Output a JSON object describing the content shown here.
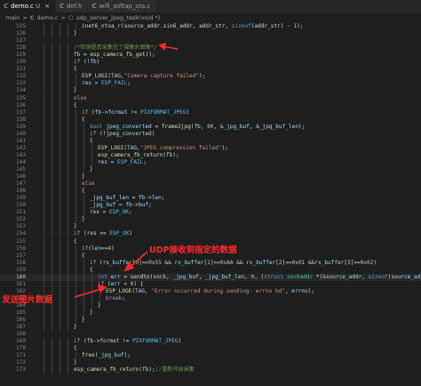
{
  "tabs": [
    {
      "icon": "c-file-icon",
      "label": "demo.c",
      "badge": "U",
      "active": true
    },
    {
      "icon": "c-file-icon",
      "label": "def.h",
      "badge": "",
      "active": false
    },
    {
      "icon": "c-file-icon",
      "label": "wifi_softap_sta.c",
      "badge": "",
      "active": false
    }
  ],
  "tab_close": "×",
  "breadcrumb": {
    "root": "main",
    "sep1": ">",
    "file": "demo.c",
    "sep2": ">",
    "func": "udp_server_jpeg_task(void *)"
  },
  "annotations": {
    "udp_recv": "UDP接收到指定的数据",
    "send_image": "发送图片数据"
  },
  "colors": {
    "annotation": "#ff2a2a",
    "background": "#1e1e1e"
  },
  "lines": [
    {
      "no": "125",
      "indent": 5,
      "tokens": [
        [
          "f",
          "inet6_ntoa_r"
        ],
        [
          "p",
          "(source_addr.sin6_addr, addr_str, "
        ],
        [
          "k",
          "sizeof"
        ],
        [
          "p",
          "(addr_str) - "
        ],
        [
          "n",
          "1"
        ],
        [
          "p",
          ");"
        ]
      ]
    },
    {
      "no": "126",
      "indent": 4,
      "tokens": [
        [
          "p",
          "}"
        ]
      ]
    },
    {
      "no": "127",
      "indent": 0,
      "tokens": []
    },
    {
      "no": "128",
      "indent": 4,
      "tokens": [
        [
          "c",
          "/*检测是否采集完了摄像头图像*/"
        ]
      ]
    },
    {
      "no": "129",
      "indent": 4,
      "tokens": [
        [
          "v",
          "fb"
        ],
        [
          "p",
          " = "
        ],
        [
          "f",
          "esp_camera_fb_get"
        ],
        [
          "p",
          "();"
        ]
      ]
    },
    {
      "no": "130",
      "indent": 4,
      "tokens": [
        [
          "kc",
          "if"
        ],
        [
          "p",
          " (!"
        ],
        [
          "v",
          "fb"
        ],
        [
          "p",
          ")"
        ]
      ]
    },
    {
      "no": "131",
      "indent": 4,
      "tokens": [
        [
          "p",
          "{"
        ]
      ]
    },
    {
      "no": "132",
      "indent": 5,
      "tokens": [
        [
          "f",
          "ESP_LOGI"
        ],
        [
          "p",
          "("
        ],
        [
          "v",
          "TAG"
        ],
        [
          "p",
          ","
        ],
        [
          "s",
          "\"Camera capture failed\""
        ],
        [
          "p",
          ");"
        ]
      ]
    },
    {
      "no": "133",
      "indent": 5,
      "tokens": [
        [
          "v",
          "res"
        ],
        [
          "p",
          " = "
        ],
        [
          "m",
          "ESP_FAIL"
        ],
        [
          "p",
          ";"
        ]
      ]
    },
    {
      "no": "134",
      "indent": 4,
      "tokens": [
        [
          "p",
          "}"
        ]
      ]
    },
    {
      "no": "135",
      "indent": 4,
      "tokens": [
        [
          "kc",
          "else"
        ]
      ]
    },
    {
      "no": "136",
      "indent": 4,
      "tokens": [
        [
          "p",
          "{"
        ]
      ]
    },
    {
      "no": "137",
      "indent": 5,
      "tokens": [
        [
          "kc",
          "if"
        ],
        [
          "p",
          " ("
        ],
        [
          "v",
          "fb"
        ],
        [
          "p",
          "->"
        ],
        [
          "v",
          "format"
        ],
        [
          "p",
          " != "
        ],
        [
          "m",
          "PIXFORMAT_JPEG"
        ],
        [
          "p",
          ")"
        ]
      ]
    },
    {
      "no": "138",
      "indent": 5,
      "tokens": [
        [
          "p",
          "{"
        ]
      ]
    },
    {
      "no": "139",
      "indent": 6,
      "tokens": [
        [
          "k",
          "bool"
        ],
        [
          "p",
          " "
        ],
        [
          "v",
          "jpeg_converted"
        ],
        [
          "p",
          " = "
        ],
        [
          "f",
          "frame2jpg"
        ],
        [
          "p",
          "("
        ],
        [
          "v",
          "fb"
        ],
        [
          "p",
          ", "
        ],
        [
          "n",
          "80"
        ],
        [
          "p",
          ", &"
        ],
        [
          "v",
          "_jpg_buf"
        ],
        [
          "p",
          ", &"
        ],
        [
          "v",
          "_jpg_buf_len"
        ],
        [
          "p",
          ");"
        ]
      ]
    },
    {
      "no": "140",
      "indent": 6,
      "tokens": [
        [
          "kc",
          "if"
        ],
        [
          "p",
          " (!"
        ],
        [
          "v",
          "jpeg_converted"
        ],
        [
          "p",
          ")"
        ]
      ]
    },
    {
      "no": "141",
      "indent": 6,
      "tokens": [
        [
          "p",
          "{"
        ]
      ]
    },
    {
      "no": "142",
      "indent": 7,
      "tokens": [
        [
          "f",
          "ESP_LOGI"
        ],
        [
          "p",
          "("
        ],
        [
          "v",
          "TAG"
        ],
        [
          "p",
          ","
        ],
        [
          "s",
          "\"JPEG compression failed\""
        ],
        [
          "p",
          ");"
        ]
      ]
    },
    {
      "no": "143",
      "indent": 7,
      "tokens": [
        [
          "f",
          "esp_camera_fb_return"
        ],
        [
          "p",
          "("
        ],
        [
          "v",
          "fb"
        ],
        [
          "p",
          ");"
        ]
      ]
    },
    {
      "no": "144",
      "indent": 7,
      "tokens": [
        [
          "v",
          "res"
        ],
        [
          "p",
          " = "
        ],
        [
          "m",
          "ESP_FAIL"
        ],
        [
          "p",
          ";"
        ]
      ]
    },
    {
      "no": "145",
      "indent": 6,
      "tokens": [
        [
          "p",
          "}"
        ]
      ]
    },
    {
      "no": "146",
      "indent": 5,
      "tokens": [
        [
          "p",
          "}"
        ]
      ]
    },
    {
      "no": "147",
      "indent": 5,
      "tokens": [
        [
          "kc",
          "else"
        ]
      ]
    },
    {
      "no": "148",
      "indent": 5,
      "tokens": [
        [
          "p",
          "{"
        ]
      ]
    },
    {
      "no": "149",
      "indent": 6,
      "tokens": [
        [
          "v",
          "_jpg_buf_len"
        ],
        [
          "p",
          " = "
        ],
        [
          "v",
          "fb"
        ],
        [
          "p",
          "->"
        ],
        [
          "v",
          "len"
        ],
        [
          "p",
          ";"
        ]
      ]
    },
    {
      "no": "150",
      "indent": 6,
      "tokens": [
        [
          "v",
          "_jpg_buf"
        ],
        [
          "p",
          " = "
        ],
        [
          "v",
          "fb"
        ],
        [
          "p",
          "->"
        ],
        [
          "v",
          "buf"
        ],
        [
          "p",
          ";"
        ]
      ]
    },
    {
      "no": "151",
      "indent": 6,
      "tokens": [
        [
          "v",
          "res"
        ],
        [
          "p",
          " = "
        ],
        [
          "m",
          "ESP_OK"
        ],
        [
          "p",
          ";"
        ]
      ]
    },
    {
      "no": "152",
      "indent": 5,
      "tokens": [
        [
          "p",
          "}"
        ]
      ]
    },
    {
      "no": "153",
      "indent": 4,
      "tokens": [
        [
          "p",
          "}"
        ]
      ]
    },
    {
      "no": "154",
      "indent": 4,
      "tokens": [
        [
          "kc",
          "if"
        ],
        [
          "p",
          " ("
        ],
        [
          "v",
          "res"
        ],
        [
          "p",
          " == "
        ],
        [
          "m",
          "ESP_OK"
        ],
        [
          "p",
          ")"
        ]
      ]
    },
    {
      "no": "155",
      "indent": 4,
      "tokens": [
        [
          "p",
          "{"
        ]
      ]
    },
    {
      "no": "156",
      "indent": 5,
      "tokens": [
        [
          "kc",
          "if"
        ],
        [
          "p",
          "("
        ],
        [
          "v",
          "len"
        ],
        [
          "p",
          "=="
        ],
        [
          "n",
          "4"
        ],
        [
          "p",
          ")"
        ]
      ]
    },
    {
      "no": "157",
      "indent": 5,
      "tokens": [
        [
          "p",
          "{"
        ]
      ]
    },
    {
      "no": "158",
      "indent": 6,
      "tokens": [
        [
          "kc",
          "if"
        ],
        [
          "p",
          " ("
        ],
        [
          "v",
          "rx_buffer"
        ],
        [
          "p",
          "["
        ],
        [
          "n",
          "0"
        ],
        [
          "p",
          "]=="
        ],
        [
          "n",
          "0x55"
        ],
        [
          "p",
          " && "
        ],
        [
          "v",
          "rx_buffer"
        ],
        [
          "p",
          "["
        ],
        [
          "n",
          "1"
        ],
        [
          "p",
          "]=="
        ],
        [
          "n",
          "0xAA"
        ],
        [
          "p",
          " && "
        ],
        [
          "v",
          "rx_buffer"
        ],
        [
          "p",
          "["
        ],
        [
          "n",
          "2"
        ],
        [
          "p",
          "]=="
        ],
        [
          "n",
          "0x01"
        ],
        [
          "p",
          " &&"
        ],
        [
          "v",
          "rx_buffer"
        ],
        [
          "p",
          "["
        ],
        [
          "n",
          "3"
        ],
        [
          "p",
          "]=="
        ],
        [
          "n",
          "0x02"
        ],
        [
          "p",
          ")"
        ]
      ]
    },
    {
      "no": "159",
      "indent": 6,
      "tokens": [
        [
          "p",
          "{"
        ]
      ]
    },
    {
      "no": "160",
      "indent": 7,
      "hl": true,
      "tokens": [
        [
          "k",
          "int"
        ],
        [
          "p",
          " "
        ],
        [
          "v",
          "err"
        ],
        [
          "p",
          " = "
        ],
        [
          "f",
          "sendto"
        ],
        [
          "p",
          "("
        ],
        [
          "v",
          "sock"
        ],
        [
          "p",
          ", "
        ],
        [
          "v",
          "_jpg_buf"
        ],
        [
          "p",
          ", "
        ],
        [
          "v",
          "_jpg_buf_len"
        ],
        [
          "p",
          ", "
        ],
        [
          "n",
          "0"
        ],
        [
          "p",
          ", ("
        ],
        [
          "k",
          "struct"
        ],
        [
          "p",
          " "
        ],
        [
          "t",
          "sockaddr"
        ],
        [
          "p",
          " *)&"
        ],
        [
          "v",
          "source_addr"
        ],
        [
          "p",
          ", "
        ],
        [
          "k",
          "sizeof"
        ],
        [
          "p",
          "("
        ],
        [
          "v",
          "source_addr"
        ],
        [
          "p",
          "));"
        ]
      ]
    },
    {
      "no": "161",
      "indent": 7,
      "tokens": [
        [
          "kc",
          "if"
        ],
        [
          "p",
          " ("
        ],
        [
          "v",
          "err"
        ],
        [
          "p",
          " < "
        ],
        [
          "n",
          "0"
        ],
        [
          "p",
          ") {"
        ]
      ]
    },
    {
      "no": "162",
      "indent": 8,
      "tokens": [
        [
          "f",
          "ESP_LOGE"
        ],
        [
          "p",
          "("
        ],
        [
          "v",
          "TAG"
        ],
        [
          "p",
          ", "
        ],
        [
          "s",
          "\"Error occurred during sending: errno %d\""
        ],
        [
          "p",
          ", "
        ],
        [
          "v",
          "errno"
        ],
        [
          "p",
          ");"
        ]
      ]
    },
    {
      "no": "163",
      "indent": 8,
      "tokens": [
        [
          "kc",
          "break"
        ],
        [
          "p",
          ";"
        ]
      ]
    },
    {
      "no": "164",
      "indent": 7,
      "tokens": [
        [
          "p",
          "}"
        ]
      ]
    },
    {
      "no": "165",
      "indent": 6,
      "tokens": [
        [
          "p",
          "}"
        ]
      ]
    },
    {
      "no": "166",
      "indent": 5,
      "tokens": [
        [
          "p",
          "}"
        ]
      ]
    },
    {
      "no": "167",
      "indent": 4,
      "tokens": [
        [
          "p",
          "}"
        ]
      ]
    },
    {
      "no": "168",
      "indent": 0,
      "tokens": []
    },
    {
      "no": "169",
      "indent": 4,
      "tokens": [
        [
          "kc",
          "if"
        ],
        [
          "p",
          " ("
        ],
        [
          "v",
          "fb"
        ],
        [
          "p",
          "->"
        ],
        [
          "v",
          "format"
        ],
        [
          "p",
          " != "
        ],
        [
          "m",
          "PIXFORMAT_JPEG"
        ],
        [
          "p",
          ")"
        ]
      ]
    },
    {
      "no": "170",
      "indent": 4,
      "tokens": [
        [
          "p",
          "{"
        ]
      ]
    },
    {
      "no": "171",
      "indent": 5,
      "tokens": [
        [
          "f",
          "free"
        ],
        [
          "p",
          "("
        ],
        [
          "v",
          "_jpg_buf"
        ],
        [
          "p",
          ");"
        ]
      ]
    },
    {
      "no": "172",
      "indent": 4,
      "tokens": [
        [
          "p",
          "}"
        ]
      ]
    },
    {
      "no": "173",
      "indent": 4,
      "tokens": [
        [
          "f",
          "esp_camera_fb_return"
        ],
        [
          "p",
          "("
        ],
        [
          "v",
          "fb"
        ],
        [
          "p",
          ");"
        ],
        [
          "c",
          "//重新开始采集"
        ]
      ]
    }
  ]
}
